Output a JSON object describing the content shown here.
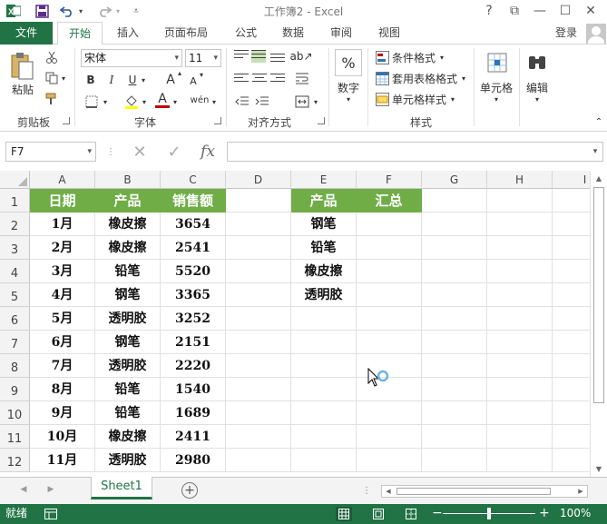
{
  "window": {
    "title": "工作簿2 - Excel"
  },
  "quick_access": {
    "excel_icon": "excel-logo-icon",
    "save_icon": "save-icon",
    "undo_icon": "undo-icon",
    "redo_icon": "redo-icon",
    "customize_icon": "customize-qat-icon"
  },
  "window_controls": {
    "help": "?",
    "restore_ribbon": "⧉",
    "minimize": "—",
    "maximize": "☐",
    "close": "✕"
  },
  "tabs": {
    "file": "文件",
    "home": "开始",
    "insert": "插入",
    "page_layout": "页面布局",
    "formulas": "公式",
    "data": "数据",
    "review": "审阅",
    "view": "视图",
    "login": "登录"
  },
  "ribbon": {
    "clipboard": {
      "paste": "粘贴",
      "label": "剪贴板"
    },
    "font": {
      "name": "宋体",
      "size": "11",
      "bold": "B",
      "italic": "I",
      "underline": "U",
      "grow": "A",
      "shrink": "A",
      "font_color": "A",
      "phonetic": "wén",
      "label": "字体"
    },
    "alignment": {
      "label": "对齐方式"
    },
    "number": {
      "symbol": "%",
      "label": "数字"
    },
    "styles": {
      "conditional": "条件格式",
      "table": "套用表格格式",
      "cell": "单元格样式",
      "label": "样式"
    },
    "cells": {
      "label": "单元格"
    },
    "editing": {
      "label": "编辑"
    }
  },
  "formula_bar": {
    "name_box": "F7",
    "cancel": "✕",
    "enter": "✓",
    "fx": "fx",
    "value": ""
  },
  "sheet": {
    "columns": [
      "A",
      "B",
      "C",
      "D",
      "E",
      "F",
      "G",
      "H",
      "I"
    ],
    "rows": [
      "1",
      "2",
      "3",
      "4",
      "5",
      "6",
      "7",
      "8",
      "9",
      "10",
      "11",
      "12"
    ],
    "header_row": {
      "A": "日期",
      "B": "产品",
      "C": "销售额",
      "E": "产品",
      "F": "汇总"
    },
    "data": [
      {
        "A": "1月",
        "B": "橡皮擦",
        "C": "3654",
        "E": "钢笔"
      },
      {
        "A": "2月",
        "B": "橡皮擦",
        "C": "2541",
        "E": "铅笔"
      },
      {
        "A": "3月",
        "B": "铅笔",
        "C": "5520",
        "E": "橡皮擦"
      },
      {
        "A": "4月",
        "B": "钢笔",
        "C": "3365",
        "E": "透明胶"
      },
      {
        "A": "5月",
        "B": "透明胶",
        "C": "3252"
      },
      {
        "A": "6月",
        "B": "钢笔",
        "C": "2151"
      },
      {
        "A": "7月",
        "B": "透明胶",
        "C": "2220"
      },
      {
        "A": "8月",
        "B": "铅笔",
        "C": "1540"
      },
      {
        "A": "9月",
        "B": "铅笔",
        "C": "1689"
      },
      {
        "A": "10月",
        "B": "橡皮擦",
        "C": "2411"
      },
      {
        "A": "11月",
        "B": "透明胶",
        "C": "2980"
      }
    ],
    "header_color": "#70ad47"
  },
  "sheet_tabs": {
    "active": "Sheet1",
    "add": "+"
  },
  "status": {
    "ready": "就绪",
    "zoom": "100%",
    "zoom_minus": "−",
    "zoom_plus": "+"
  },
  "theme": {
    "accent": "#217346"
  }
}
